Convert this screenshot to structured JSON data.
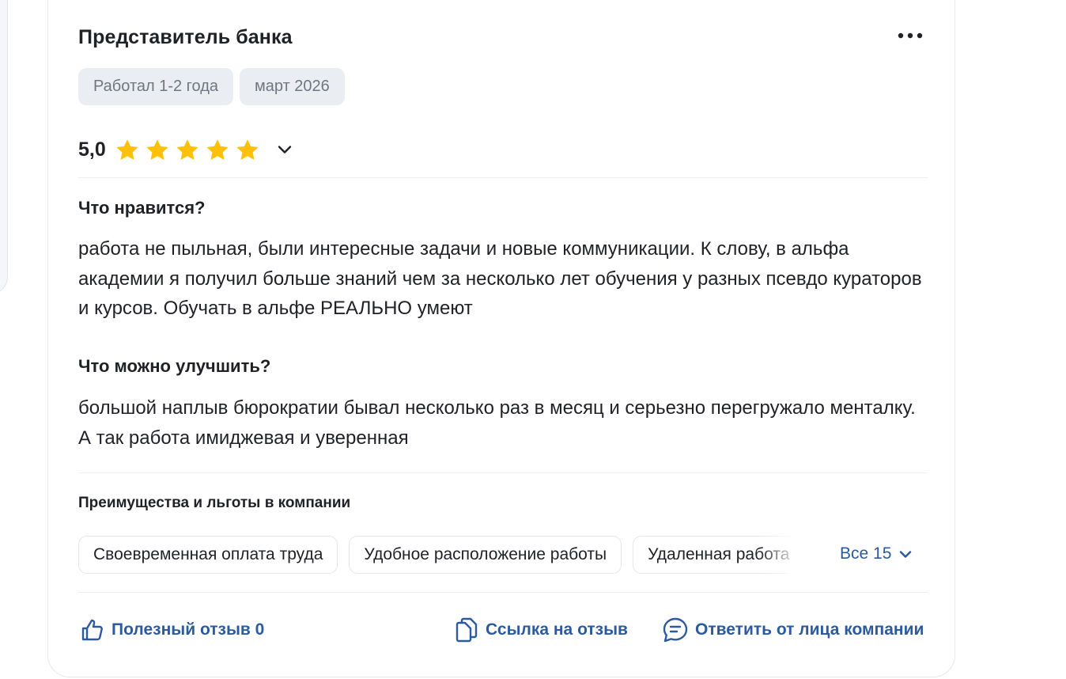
{
  "review": {
    "title": "Представитель банка",
    "tags": [
      "Работал 1-2 года",
      "март 2026"
    ],
    "rating": "5,0",
    "stars_filled": 5,
    "stars_total": 5,
    "likes_title": "Что нравится?",
    "likes_text": "работа не пыльная, были интересные задачи и новые коммуникации. К слову, в альфа академии я получил больше знаний чем за несколько лет обучения у разных псевдо кураторов и курсов. Обучать в альфе РЕАЛЬНО умеют",
    "improve_title": "Что можно улучшить?",
    "improve_text": "большой наплыв бюрократии бывал несколько раз в месяц и серьезно перегружало менталку. А так работа имиджевая и уверенная"
  },
  "benefits": {
    "title": "Преимущества и льготы в компании",
    "chips": [
      "Своевременная оплата труда",
      "Удобное расположение работы",
      "Удаленная работа"
    ],
    "show_all": "Все 15"
  },
  "actions": {
    "helpful": "Полезный отзыв 0",
    "link": "Ссылка на отзыв",
    "reply": "Ответить от лица компании"
  },
  "colors": {
    "star": "#ffc107",
    "link": "#2b5a9e",
    "tag_bg": "#eaeef3"
  },
  "icons": {
    "menu": "more-dots-icon",
    "expand": "chevron-down-icon",
    "helpful": "thumbs-up-icon",
    "link": "copy-link-icon",
    "reply": "chat-bubble-icon"
  }
}
